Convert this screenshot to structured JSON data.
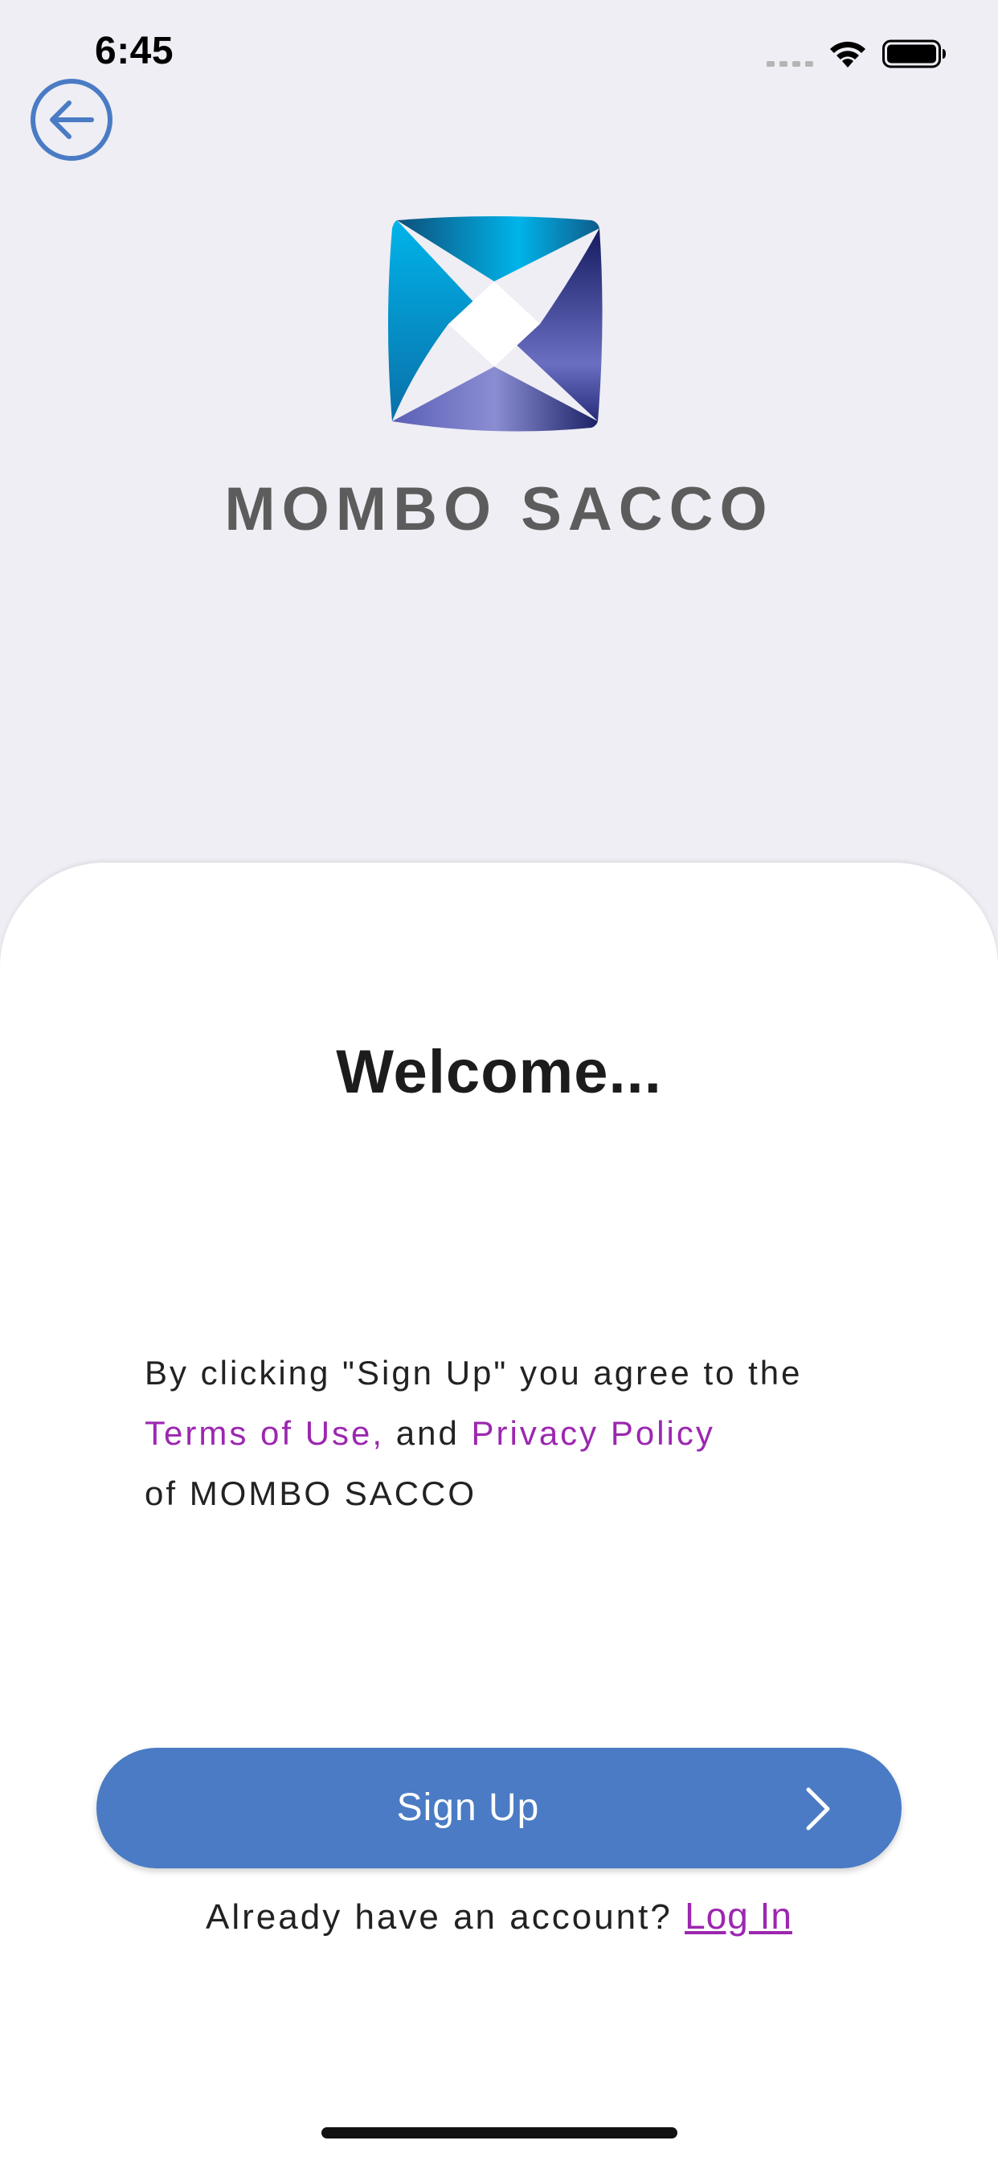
{
  "status_bar": {
    "time": "6:45"
  },
  "header": {
    "brand_name": "MOMBO SACCO"
  },
  "welcome": {
    "title": "Welcome..."
  },
  "terms": {
    "line1": "By clicking \"Sign Up\" you agree to the",
    "terms_link": "Terms of Use,",
    "and_text": " and ",
    "privacy_link": "Privacy Policy",
    "line3": "of MOMBO SACCO"
  },
  "signup_button": {
    "label": "Sign Up"
  },
  "login": {
    "prompt": "Already have an account?",
    "link": "Log In"
  },
  "colors": {
    "background": "#eeeef4",
    "accent_blue": "#4a7bc4",
    "link_purple": "#9c27b0",
    "brand_gray": "#5c5c5c"
  },
  "icons": [
    "signal-icon",
    "wifi-icon",
    "battery-icon",
    "back-arrow-icon",
    "app-logo-icon",
    "chevron-right-icon"
  ]
}
